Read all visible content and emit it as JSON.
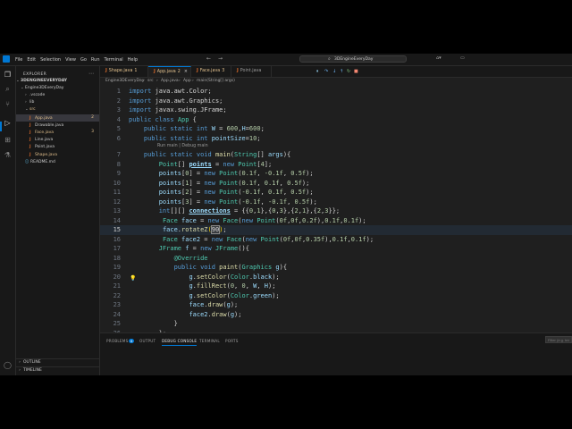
{
  "menu": [
    "File",
    "Edit",
    "Selection",
    "View",
    "Go",
    "Run",
    "Terminal",
    "Help"
  ],
  "command_center": "3DEngineEveryDay",
  "sidebar": {
    "title": "EXPLORER",
    "root": "3DENGINEEVERYDAY",
    "folder": "Engine3DEveryDay",
    "items": [
      {
        "label": ".vscode",
        "type": "folder"
      },
      {
        "label": "lib",
        "type": "folder"
      },
      {
        "label": "src",
        "type": "folder",
        "color": "#e2c08d"
      },
      {
        "label": "App.java",
        "type": "java",
        "color": "#e2c08d",
        "badge": "2"
      },
      {
        "label": "Drawable.java",
        "type": "java"
      },
      {
        "label": "Face.java",
        "type": "java",
        "color": "#e2c08d",
        "badge": "3"
      },
      {
        "label": "Line.java",
        "type": "java"
      },
      {
        "label": "Point.java",
        "type": "java"
      },
      {
        "label": "Shape.java",
        "type": "java",
        "color": "#e2c08d"
      },
      {
        "label": "README.md",
        "type": "md"
      }
    ],
    "outline": "OUTLINE",
    "timeline": "TIMELINE"
  },
  "tabs": [
    {
      "label": "Shape.java",
      "num": "1",
      "active": false
    },
    {
      "label": "App.java",
      "num": "2",
      "active": true
    },
    {
      "label": "Face.java",
      "num": "3",
      "active": false
    },
    {
      "label": "Point.java",
      "num": "",
      "active": false
    }
  ],
  "breadcrumb": [
    "Engine3DEveryDay",
    "src",
    "App.java",
    "App",
    "main(String[] args)"
  ],
  "codelens": "Run main | Debug main",
  "code_lines": [
    {
      "n": "1",
      "tokens": [
        [
          "k",
          "import "
        ],
        [
          "a",
          "java.awt.Color;"
        ]
      ]
    },
    {
      "n": "2",
      "tokens": [
        [
          "k",
          "import "
        ],
        [
          "a",
          "java.awt.Graphics;"
        ]
      ]
    },
    {
      "n": "3",
      "tokens": [
        [
          "k",
          "import "
        ],
        [
          "a",
          "javax.swing.JFrame;"
        ]
      ]
    },
    {
      "n": "4",
      "tokens": [
        [
          "k",
          "public "
        ],
        [
          "k",
          "class "
        ],
        [
          "t",
          "App "
        ],
        [
          "p",
          "{"
        ]
      ]
    },
    {
      "n": "5",
      "tokens": [
        [
          "a",
          "    "
        ],
        [
          "k",
          "public static int "
        ],
        [
          "v",
          "W"
        ],
        [
          "p",
          " = "
        ],
        [
          "n",
          "600"
        ],
        [
          "p",
          ","
        ],
        [
          "v",
          "H"
        ],
        [
          "p",
          "="
        ],
        [
          "n",
          "600"
        ],
        [
          "p",
          ";"
        ]
      ]
    },
    {
      "n": "6",
      "tokens": [
        [
          "a",
          "    "
        ],
        [
          "k",
          "public static int "
        ],
        [
          "v",
          "pointSize"
        ],
        [
          "p",
          "="
        ],
        [
          "n",
          "10"
        ],
        [
          "p",
          ";"
        ]
      ]
    },
    {
      "n": "7",
      "tokens": [
        [
          "a",
          "    "
        ],
        [
          "k",
          "public static void "
        ],
        [
          "f",
          "main"
        ],
        [
          "p",
          "("
        ],
        [
          "t",
          "String"
        ],
        [
          "p",
          "[] "
        ],
        [
          "v",
          "args"
        ],
        [
          "p",
          "){"
        ]
      ]
    },
    {
      "n": "8",
      "tokens": [
        [
          "a",
          "        "
        ],
        [
          "t",
          "Point"
        ],
        [
          "p",
          "[] "
        ],
        [
          "vb",
          "points"
        ],
        [
          "p",
          " = "
        ],
        [
          "k",
          "new "
        ],
        [
          "t",
          "Point"
        ],
        [
          "p",
          "["
        ],
        [
          "n",
          "4"
        ],
        [
          "p",
          "];"
        ]
      ]
    },
    {
      "n": "9",
      "tokens": [
        [
          "a",
          "        "
        ],
        [
          "v",
          "points"
        ],
        [
          "p",
          "["
        ],
        [
          "n",
          "0"
        ],
        [
          "p",
          "] = "
        ],
        [
          "k",
          "new "
        ],
        [
          "t",
          "Point"
        ],
        [
          "p",
          "("
        ],
        [
          "n",
          "0.1f"
        ],
        [
          "p",
          ", "
        ],
        [
          "n",
          "-0.1f"
        ],
        [
          "p",
          ", "
        ],
        [
          "n",
          "0.5f"
        ],
        [
          "p",
          ");"
        ]
      ]
    },
    {
      "n": "10",
      "tokens": [
        [
          "a",
          "        "
        ],
        [
          "v",
          "points"
        ],
        [
          "p",
          "["
        ],
        [
          "n",
          "1"
        ],
        [
          "p",
          "] = "
        ],
        [
          "k",
          "new "
        ],
        [
          "t",
          "Point"
        ],
        [
          "p",
          "("
        ],
        [
          "n",
          "0.1f"
        ],
        [
          "p",
          ", "
        ],
        [
          "n",
          "0.1f"
        ],
        [
          "p",
          ", "
        ],
        [
          "n",
          "0.5f"
        ],
        [
          "p",
          ");"
        ]
      ]
    },
    {
      "n": "11",
      "tokens": [
        [
          "a",
          "        "
        ],
        [
          "v",
          "points"
        ],
        [
          "p",
          "["
        ],
        [
          "n",
          "2"
        ],
        [
          "p",
          "] = "
        ],
        [
          "k",
          "new "
        ],
        [
          "t",
          "Point"
        ],
        [
          "p",
          "("
        ],
        [
          "n",
          "-0.1f"
        ],
        [
          "p",
          ", "
        ],
        [
          "n",
          "0.1f"
        ],
        [
          "p",
          ", "
        ],
        [
          "n",
          "0.5f"
        ],
        [
          "p",
          ");"
        ]
      ]
    },
    {
      "n": "12",
      "tokens": [
        [
          "a",
          "        "
        ],
        [
          "v",
          "points"
        ],
        [
          "p",
          "["
        ],
        [
          "n",
          "3"
        ],
        [
          "p",
          "] = "
        ],
        [
          "k",
          "new "
        ],
        [
          "t",
          "Point"
        ],
        [
          "p",
          "("
        ],
        [
          "n",
          "-0.1f"
        ],
        [
          "p",
          ", "
        ],
        [
          "n",
          "-0.1f"
        ],
        [
          "p",
          ", "
        ],
        [
          "n",
          "0.5f"
        ],
        [
          "p",
          ");"
        ]
      ]
    },
    {
      "n": "13",
      "tokens": [
        [
          "a",
          "        "
        ],
        [
          "k",
          "int"
        ],
        [
          "p",
          "[][] "
        ],
        [
          "vb",
          "connections"
        ],
        [
          "p",
          " = {{"
        ],
        [
          "n",
          "0"
        ],
        [
          "p",
          ","
        ],
        [
          "n",
          "1"
        ],
        [
          "p",
          "},{"
        ],
        [
          "n",
          "0"
        ],
        [
          "p",
          ","
        ],
        [
          "n",
          "3"
        ],
        [
          "p",
          "},{"
        ],
        [
          "n",
          "2"
        ],
        [
          "p",
          ","
        ],
        [
          "n",
          "1"
        ],
        [
          "p",
          "},{"
        ],
        [
          "n",
          "2"
        ],
        [
          "p",
          ","
        ],
        [
          "n",
          "3"
        ],
        [
          "p",
          "}};"
        ]
      ]
    },
    {
      "n": "14",
      "tokens": [
        [
          "a",
          "         "
        ],
        [
          "t",
          "Face "
        ],
        [
          "v",
          "face"
        ],
        [
          "p",
          " = "
        ],
        [
          "k",
          "new "
        ],
        [
          "t",
          "Face"
        ],
        [
          "p",
          "("
        ],
        [
          "k",
          "new "
        ],
        [
          "t",
          "Point"
        ],
        [
          "p",
          "("
        ],
        [
          "n",
          "0f"
        ],
        [
          "p",
          ","
        ],
        [
          "n",
          "0f"
        ],
        [
          "p",
          ","
        ],
        [
          "n",
          "0.2f"
        ],
        [
          "p",
          "),"
        ],
        [
          "n",
          "0.1f"
        ],
        [
          "p",
          ","
        ],
        [
          "n",
          "0.1f"
        ],
        [
          "p",
          ");"
        ]
      ]
    },
    {
      "n": "15",
      "cur": true,
      "tokens": [
        [
          "a",
          "         "
        ],
        [
          "v",
          "face"
        ],
        [
          "p",
          "."
        ],
        [
          "f",
          "rotateZ"
        ],
        [
          "br",
          "("
        ],
        [
          "hl",
          "90"
        ],
        [
          "br",
          ")"
        ],
        [
          "p",
          ";"
        ]
      ]
    },
    {
      "n": "16",
      "tokens": [
        [
          "a",
          "         "
        ],
        [
          "t",
          "Face "
        ],
        [
          "v",
          "face2"
        ],
        [
          "p",
          " = "
        ],
        [
          "k",
          "new "
        ],
        [
          "t",
          "Face"
        ],
        [
          "p",
          "("
        ],
        [
          "k",
          "new "
        ],
        [
          "t",
          "Point"
        ],
        [
          "p",
          "("
        ],
        [
          "n",
          "0f"
        ],
        [
          "p",
          ","
        ],
        [
          "n",
          "0f"
        ],
        [
          "p",
          ","
        ],
        [
          "n",
          "0.35f"
        ],
        [
          "p",
          "),"
        ],
        [
          "n",
          "0.1f"
        ],
        [
          "p",
          ","
        ],
        [
          "n",
          "0.1f"
        ],
        [
          "p",
          ");"
        ]
      ]
    },
    {
      "n": "17",
      "tokens": [
        [
          "a",
          "        "
        ],
        [
          "t",
          "JFrame "
        ],
        [
          "v",
          "f"
        ],
        [
          "p",
          " = "
        ],
        [
          "k",
          "new "
        ],
        [
          "t",
          "JFrame"
        ],
        [
          "p",
          "(){"
        ]
      ]
    },
    {
      "n": "18",
      "tokens": [
        [
          "a",
          "            "
        ],
        [
          "t",
          "@Override"
        ]
      ]
    },
    {
      "n": "19",
      "tokens": [
        [
          "a",
          "            "
        ],
        [
          "k",
          "public void "
        ],
        [
          "f",
          "paint"
        ],
        [
          "p",
          "("
        ],
        [
          "t",
          "Graphics "
        ],
        [
          "v",
          "g"
        ],
        [
          "p",
          "){"
        ]
      ]
    },
    {
      "n": "20",
      "tokens": [
        [
          "a",
          "                "
        ],
        [
          "v",
          "g"
        ],
        [
          "p",
          "."
        ],
        [
          "f",
          "setColor"
        ],
        [
          "p",
          "("
        ],
        [
          "t",
          "Color"
        ],
        [
          "p",
          "."
        ],
        [
          "v",
          "black"
        ],
        [
          "p",
          ");"
        ]
      ]
    },
    {
      "n": "21",
      "tokens": [
        [
          "a",
          "                "
        ],
        [
          "v",
          "g"
        ],
        [
          "p",
          "."
        ],
        [
          "f",
          "fillRect"
        ],
        [
          "p",
          "("
        ],
        [
          "n",
          "0"
        ],
        [
          "p",
          ", "
        ],
        [
          "n",
          "0"
        ],
        [
          "p",
          ", "
        ],
        [
          "v",
          "W"
        ],
        [
          "p",
          ", "
        ],
        [
          "v",
          "H"
        ],
        [
          "p",
          ");"
        ]
      ]
    },
    {
      "n": "22",
      "tokens": [
        [
          "a",
          "                "
        ],
        [
          "v",
          "g"
        ],
        [
          "p",
          "."
        ],
        [
          "f",
          "setColor"
        ],
        [
          "p",
          "("
        ],
        [
          "t",
          "Color"
        ],
        [
          "p",
          "."
        ],
        [
          "v",
          "green"
        ],
        [
          "p",
          ");"
        ]
      ]
    },
    {
      "n": "23",
      "tokens": [
        [
          "a",
          "                "
        ],
        [
          "v",
          "face"
        ],
        [
          "p",
          "."
        ],
        [
          "f",
          "draw"
        ],
        [
          "p",
          "("
        ],
        [
          "v",
          "g"
        ],
        [
          "p",
          ");"
        ]
      ]
    },
    {
      "n": "24",
      "tokens": [
        [
          "a",
          "                "
        ],
        [
          "v",
          "face2"
        ],
        [
          "p",
          "."
        ],
        [
          "f",
          "draw"
        ],
        [
          "p",
          "("
        ],
        [
          "v",
          "g"
        ],
        [
          "p",
          ");"
        ]
      ]
    },
    {
      "n": "25",
      "tokens": [
        [
          "a",
          "            "
        ],
        [
          "p",
          "}"
        ]
      ]
    },
    {
      "n": "26",
      "tokens": [
        [
          "a",
          "        "
        ],
        [
          "p",
          "};"
        ]
      ]
    }
  ],
  "panel": {
    "tabs": [
      {
        "label": "PROBLEMS",
        "badge": "6",
        "active": false
      },
      {
        "label": "OUTPUT",
        "active": false
      },
      {
        "label": "DEBUG CONSOLE",
        "active": true
      },
      {
        "label": "TERMINAL",
        "active": false
      },
      {
        "label": "PORTS",
        "active": false
      }
    ],
    "filter_placeholder": "Filter (e.g. text"
  },
  "colors": {
    "accent": "#0078d4",
    "background": "#1f1f1f",
    "java_icon": "#e06c2a"
  }
}
